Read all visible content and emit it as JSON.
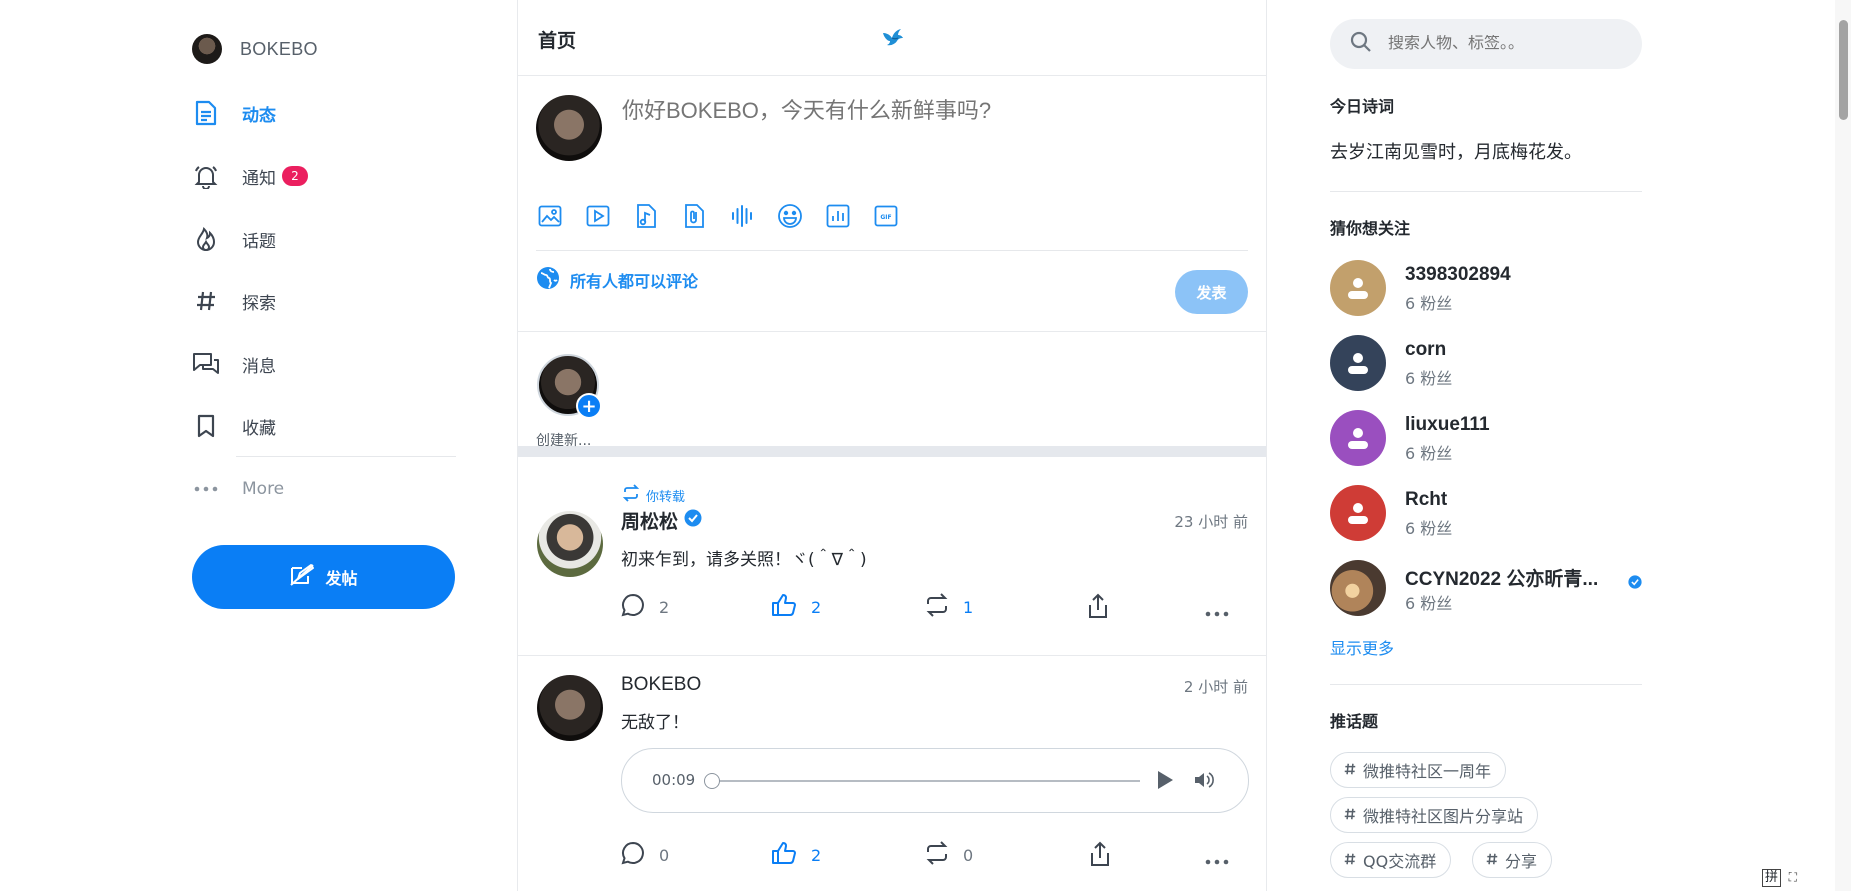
{
  "user": {
    "name": "BOKEBO"
  },
  "nav": {
    "items": [
      {
        "label": "动态",
        "icon": "document-icon"
      },
      {
        "label": "通知",
        "icon": "bell-icon",
        "badge": "2"
      },
      {
        "label": "话题",
        "icon": "flame-icon"
      },
      {
        "label": "探索",
        "icon": "hash-icon"
      },
      {
        "label": "消息",
        "icon": "chat-icon"
      },
      {
        "label": "收藏",
        "icon": "bookmark-icon"
      }
    ],
    "more": "More",
    "post_button": "发帖"
  },
  "header": {
    "title": "首页"
  },
  "composer": {
    "placeholder": "你好BOKEBO，今天有什么新鲜事吗?",
    "privacy": "所有人都可以评论",
    "publish": "发表"
  },
  "story": {
    "label": "创建新..."
  },
  "posts": [
    {
      "repost_label": "你转载",
      "author": "周松松",
      "time": "23 小时 前",
      "text": "初来乍到，请多关照！ヾ(＾∇＾)",
      "comments": "2",
      "likes": "2",
      "reposts": "1"
    },
    {
      "author": "BOKEBO",
      "time": "2 小时 前",
      "text": "无敌了！",
      "audio_time": "00:09",
      "comments": "0",
      "likes": "2",
      "reposts": "0"
    }
  ],
  "search": {
    "placeholder": "搜索人物、标签。。"
  },
  "poem": {
    "title": "今日诗词",
    "text": "去岁江南见雪时，月底梅花发。"
  },
  "suggest": {
    "title": "猜你想关注",
    "users": [
      {
        "name": "3398302894",
        "fans": "6 粉丝",
        "color": "#c2a06c"
      },
      {
        "name": "corn",
        "fans": "6 粉丝",
        "color": "#34435a"
      },
      {
        "name": "liuxue111",
        "fans": "6 粉丝",
        "color": "#9a4fbf"
      },
      {
        "name": "Rcht",
        "fans": "6 粉丝",
        "color": "#cf3c36"
      },
      {
        "name": "CCYN2022 公亦昕青...",
        "fans": "6 粉丝",
        "color": "#8a6a4e"
      }
    ],
    "show_more": "显示更多"
  },
  "topics": {
    "title": "推话题",
    "tags": [
      "微推特社区一周年",
      "微推特社区图片分享站",
      "QQ交流群",
      "分享"
    ]
  },
  "ime": {
    "label": "拼"
  },
  "colors": {
    "accent": "#0a7ef5",
    "link": "#1d8cf0",
    "badge": "#eb1f5f"
  }
}
